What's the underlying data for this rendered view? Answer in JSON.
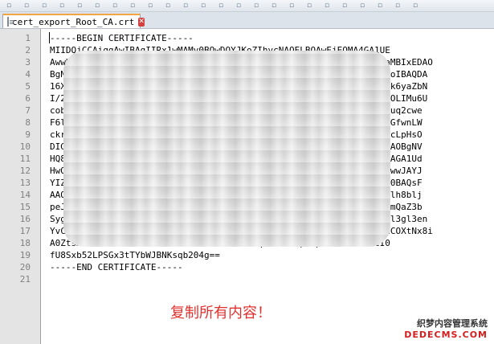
{
  "toolbar": {
    "icons": [
      "new-file-icon",
      "open-icon",
      "save-icon",
      "save-all-icon",
      "close-icon",
      "close-all-icon",
      "print-icon",
      "cut-icon",
      "copy-icon",
      "paste-icon",
      "undo-icon",
      "redo-icon",
      "find-icon",
      "replace-icon",
      "zoom-in-icon",
      "zoom-out-icon",
      "sync-icon",
      "wrap-icon",
      "indent-icon",
      "macro-record-icon",
      "macro-play-icon",
      "macro-run-icon",
      "macro-save-icon",
      "panel-icon"
    ]
  },
  "tab": {
    "title": "cert_export_Root_CA.crt",
    "close_glyph": "✕"
  },
  "editor": {
    "lines": [
      "-----BEGIN CERTIFICATE-----",
      "MIIDQjCCAiqgAwIBAgIIRx1wMAMv0BQwDQYJKoZIhvcNAQELBQAwEjEQMA4GA1UE",
      "AwwH                                                         CVaMBIxEDAO",
      "BgNV                                                         MKAoIBAQDA",
      "16Xq                                                         KHFk6yaZbN",
      "I/2g                                                         KGtOLIMu6U",
      "cobE                                                         rGBuq2cwe",
      "F6l0                                                         fqxGfwnLW",
      "ckrG                                                         soNcLpHsO",
      "DIGC/                                                        B/zAOBgNV",
      "HQ8BA                                                        DMDAGA1Ud",
      "HwQpM                                                        jcmwwJAYJ",
      "YIZIA                                                        G9w0BAQsF",
      "AAOCA                                                        pSGlh8blj",
      "peJKU                                                        7OBmQaZ3b",
      "Sygk                                                         AKEl3gl3en",
      "YvCPZ                                                        NTeCOXtNx8i",
      "A0ZtsX5BMPFCBXPa0Y2fL28v86UFs7RU3ZBUDwhqbcd2xXIpx9phYbhE34dxMcI0",
      "fU8Sxb52LPSGx3tTYbWJBNKsqb204g==",
      "-----END CERTIFICATE-----",
      ""
    ]
  },
  "annotation": {
    "text": "复制所有内容！",
    "color": "#e0312e"
  },
  "watermark": {
    "line1": "织梦内容管理系统",
    "line2": "DEDECMS.COM"
  },
  "colors": {
    "gutter": "#e4e4e4",
    "tab_accent": "#f2a541",
    "close": "#d23f3f"
  }
}
